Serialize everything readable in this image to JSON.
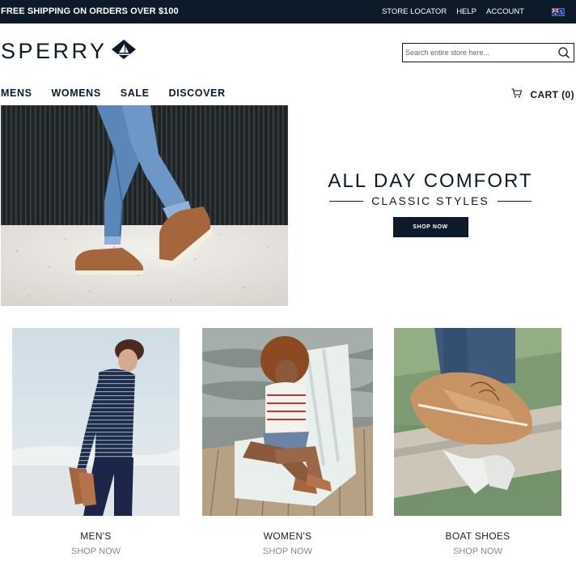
{
  "topbar": {
    "promo": "FREE SHIPPING ON ORDERS OVER $100",
    "links": [
      "STORE LOCATOR",
      "HELP",
      "ACCOUNT"
    ],
    "flag_icon": "australia-flag-icon"
  },
  "brand": {
    "name": "SPERRY",
    "logo_icon": "sailboat-logo-icon"
  },
  "search": {
    "placeholder": "Search entire store here...",
    "value": "",
    "icon": "search-icon"
  },
  "nav": {
    "items": [
      "MENS",
      "WOMENS",
      "SALE",
      "DISCOVER"
    ]
  },
  "cart": {
    "label": "CART (0)",
    "icon": "cart-icon"
  },
  "hero": {
    "title": "ALL DAY COMFORT",
    "subtitle": "CLASSIC STYLES",
    "button": "SHOP NOW"
  },
  "categories": [
    {
      "label": "MEN'S",
      "cta": "SHOP NOW"
    },
    {
      "label": "WOMEN'S",
      "cta": "SHOP NOW"
    },
    {
      "label": "BOAT SHOES",
      "cta": "SHOP NOW"
    }
  ],
  "colors": {
    "navy": "#0d1a29",
    "white": "#ffffff",
    "muted": "#8a8a8a"
  }
}
